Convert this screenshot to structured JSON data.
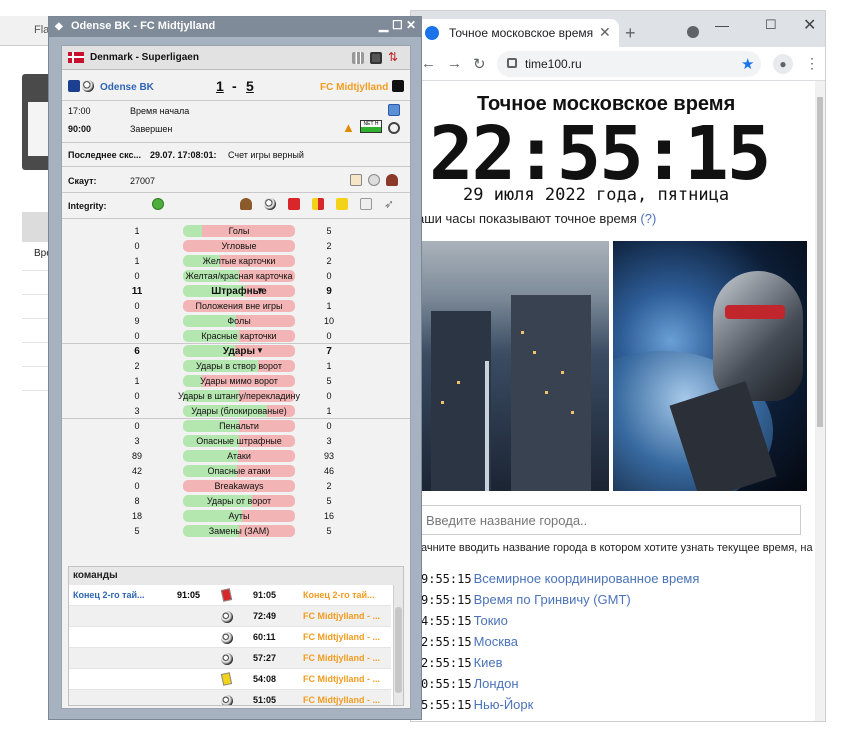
{
  "bg_app": {
    "tab_label": "Flas",
    "column_label": "Вре"
  },
  "browser": {
    "tab_title": "Точное московское время",
    "url": "time100.ru",
    "heading": "Точное московское время",
    "clock": "22:55:15",
    "date": "29 июля 2022 года, пятница",
    "note": "аши часы показывают точное время",
    "note_q": "(?)",
    "city_placeholder": "Введите название города..",
    "city_hint": "ачните вводить название города в котором хотите узнать текущее время, на",
    "timezones": [
      {
        "time": "9:55:15",
        "name": "Всемирное координированное время"
      },
      {
        "time": "9:55:15",
        "name": "Время по Гринвичу (GMT)"
      },
      {
        "time": "4:55:15",
        "name": "Токио"
      },
      {
        "time": "2:55:15",
        "name": "Москва"
      },
      {
        "time": "2:55:15",
        "name": "Киев"
      },
      {
        "time": "0:55:15",
        "name": "Лондон"
      },
      {
        "time": "5:55:15",
        "name": "Нью-Йорк"
      }
    ]
  },
  "flash": {
    "window_title": "Odense BK - FC Midtjylland",
    "league": "Denmark - Superligaen",
    "home_team": "Odense BK",
    "away_team": "FC Midtjylland",
    "score_home": "1",
    "score_sep": "-",
    "score_away": "5",
    "start_time": "17:00",
    "start_label": "Время начала",
    "minute": "90:00",
    "status": "Завершен",
    "net_label": "NET H",
    "last_change_label": "Последнее скс...",
    "last_change_time": "29.07. 17:08:01:",
    "last_change_text": "Счет игры верный",
    "scout_label": "Скаут:",
    "scout_id": "27007",
    "integrity_label": "Integrity:",
    "colors": {
      "home_bar": "#b4e6b0",
      "away_bar": "#f2b4b4",
      "team_orange": "#f29c1f",
      "team_blue": "#2f66b3"
    },
    "stats": [
      {
        "l": "1",
        "label": "Голы",
        "r": "5",
        "share": 0.17
      },
      {
        "l": "0",
        "label": "Угловые",
        "r": "2",
        "share": 0.0
      },
      {
        "l": "1",
        "label": "Желтые карточки",
        "r": "2",
        "share": 0.33
      },
      {
        "l": "0",
        "label": "Желтая/красная карточка",
        "r": "0",
        "share": 0.5
      },
      {
        "l": "11",
        "label": "Штрафные",
        "r": "9",
        "share": 0.55,
        "bold": true
      },
      {
        "l": "0",
        "label": "Положения вне игры",
        "r": "1",
        "share": 0.0
      },
      {
        "l": "9",
        "label": "Фолы",
        "r": "10",
        "share": 0.47
      },
      {
        "l": "0",
        "label": "Красные карточки",
        "r": "0",
        "share": 0.5
      },
      {
        "l": "6",
        "label": "Удары",
        "r": "7",
        "share": 0.46,
        "bold": true
      },
      {
        "l": "2",
        "label": "Удары в створ ворот",
        "r": "1",
        "share": 0.67
      },
      {
        "l": "1",
        "label": "Удары мимо ворот",
        "r": "5",
        "share": 0.17
      },
      {
        "l": "0",
        "label": "Удары в штангу/перекладину",
        "r": "0",
        "share": 0.5
      },
      {
        "l": "3",
        "label": "Удары (блокированые)",
        "r": "1",
        "share": 0.75
      },
      {
        "l": "0",
        "label": "Пенальти",
        "r": "0",
        "share": 0.5
      },
      {
        "l": "3",
        "label": "Опасные штрафные",
        "r": "3",
        "share": 0.5
      },
      {
        "l": "89",
        "label": "Атаки",
        "r": "93",
        "share": 0.49
      },
      {
        "l": "42",
        "label": "Опасные атаки",
        "r": "46",
        "share": 0.48
      },
      {
        "l": "0",
        "label": "Breakaways",
        "r": "2",
        "share": 0.0
      },
      {
        "l": "8",
        "label": "Удары от ворот",
        "r": "5",
        "share": 0.62
      },
      {
        "l": "18",
        "label": "Ауты",
        "r": "16",
        "share": 0.53
      },
      {
        "l": "5",
        "label": "Замены (ЗАМ)",
        "r": "5",
        "share": 0.5
      }
    ],
    "events_header": "команды",
    "events": [
      {
        "left": "Конец 2-го тай...",
        "left_time": "91:05",
        "time": "91:05",
        "team": "Конец 2-го тай...",
        "icon": "whistle-icon"
      },
      {
        "left": "",
        "left_time": "",
        "time": "72:49",
        "team": "FC Midtjylland - ...",
        "icon": "ball-icon"
      },
      {
        "left": "",
        "left_time": "",
        "time": "60:11",
        "team": "FC Midtjylland - ...",
        "icon": "ball-icon"
      },
      {
        "left": "",
        "left_time": "",
        "time": "57:27",
        "team": "FC Midtjylland - ...",
        "icon": "ball-icon"
      },
      {
        "left": "",
        "left_time": "",
        "time": "54:08",
        "team": "FC Midtjylland - ...",
        "icon": "yellow-card-icon"
      },
      {
        "left": "",
        "left_time": "",
        "time": "51:05",
        "team": "FC Midtjylland - ...",
        "icon": "ball-icon"
      }
    ]
  }
}
